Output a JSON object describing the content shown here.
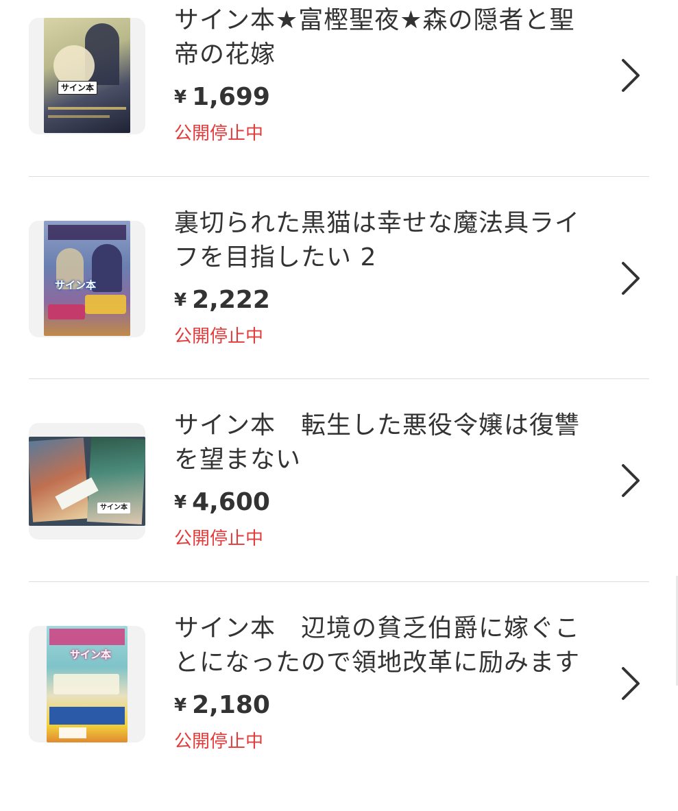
{
  "items": [
    {
      "title": "サイン本★富樫聖夜★森の隠者と聖帝の花嫁",
      "currency": "¥",
      "price": "1,699",
      "status": "公開停止中",
      "cover_sticker": "サイン本",
      "cover_colors": [
        "#c9c7a3",
        "#3a3f55",
        "#6b7a4f"
      ]
    },
    {
      "title": "裏切られた黒猫は幸せな魔法具ライフを目指したい 2",
      "currency": "¥",
      "price": "2,222",
      "status": "公開停止中",
      "cover_sticker": "サイン本",
      "cover_colors": [
        "#6a7fb0",
        "#c43a6a",
        "#f0c23a"
      ]
    },
    {
      "title": "サイン本　転生した悪役令嬢は復讐を望まない",
      "currency": "¥",
      "price": "4,600",
      "status": "公開停止中",
      "cover_sticker": "サイン本",
      "cover_colors": [
        "#4a6a8a",
        "#c07050",
        "#2f5a4a"
      ]
    },
    {
      "title": "サイン本　辺境の貧乏伯爵に嫁ぐことになったので領地改革に励みます",
      "currency": "¥",
      "price": "2,180",
      "status": "公開停止中",
      "cover_sticker": "サイン本",
      "cover_colors": [
        "#7fc3c8",
        "#d04080",
        "#f2d23a"
      ]
    }
  ]
}
